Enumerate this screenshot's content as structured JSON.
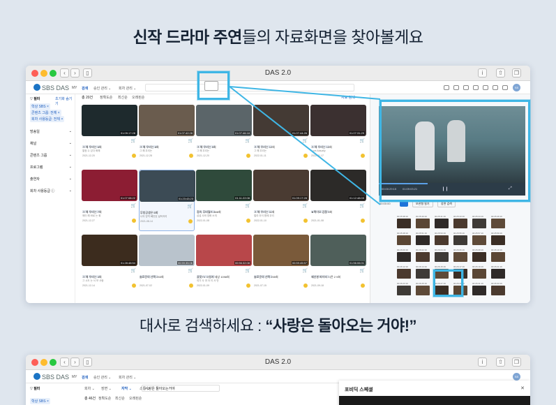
{
  "headline1": {
    "bold": "신작 드라마 주연",
    "rest": "들의 자료화면을 찾아볼게요"
  },
  "headline2": {
    "pre": "대사로 검색하세요 : ",
    "quote": "“사랑은 돌아오는 거야!”"
  },
  "window1": {
    "title": "DAS 2.0",
    "app_logo": "SBS DAS",
    "nav": [
      "MY",
      "검색",
      "승인 관리 ⌄",
      "회차 관리 ⌄"
    ],
    "search_placeholder": "",
    "filter_label": "필터",
    "filter_actions": [
      "초기화",
      "숨기기"
    ],
    "chips": [
      "학상 SBS ×",
      "콘텐츠 그룹: 전체 ×",
      "회차 사용등급: 전체 ×"
    ],
    "side_sections": [
      "방송일",
      "채널",
      "콘텐츠 그룹",
      "프로그램",
      "출연자",
      "회차 사용등급 ⓘ"
    ],
    "tabs": [
      "총 20건",
      "정확도순",
      "최신순",
      "오래된순"
    ],
    "top_right_link": "자료 검색",
    "cards": [
      {
        "dur": "01:09:17:28",
        "title": "그 해 우리는 6회",
        "sub": "열정 수 있다 화해",
        "date": "2021-12-20",
        "bg": "#1e2a2d"
      },
      {
        "dur": "01:07:42:28",
        "title": "그 해 우리는 8회",
        "sub": "그 해 우리는",
        "date": "2021-12-28",
        "bg": "#6a5c4e"
      },
      {
        "dur": "01:07:46:18",
        "title": "그 해 우리는 5회",
        "sub": "그 해 우리는",
        "date": "2021-12-20",
        "bg": "#5b6569"
      },
      {
        "dur": "01:07:44:26",
        "title": "그 해 우리는 12회",
        "sub": "그 해 우리는",
        "date": "2022-01-11",
        "bg": "#443a34"
      },
      {
        "dur": "01:07:31:29",
        "title": "그 해 우리는 13회",
        "sub": "Love Actually",
        "date": "2022-01-17",
        "bg": "#3b3030"
      },
      {
        "dur": "01:07:08:22",
        "title": "그 해 우리는 7회",
        "sub": "에이 해 바로 는 회",
        "date": "2021-12-27",
        "bg": "#8c1d33"
      },
      {
        "dur": "01:23:43:23",
        "title": "무빙공생은 6회",
        "sub": "너의 영역 빼앗았 설득하여",
        "date": "2021-08-14",
        "bg": "#3c4b55"
      },
      {
        "dur": "01:11:22:08",
        "title": "접속 무비월드 866회",
        "sub": "섭섭 사와 영화 소개",
        "date": "2022-01-08",
        "bg": "#2f4a3b"
      },
      {
        "dur": "01:09:17:28",
        "title": "그 해 우리는 11회",
        "sub": "멀리 아이 함께 우리",
        "date": "2022-01-10",
        "bg": "#4a3b32"
      },
      {
        "dur": "01:12:48:03",
        "title": "★택이오 검찰 9회",
        "sub": "",
        "date": "2021-01-08",
        "bg": "#2c2a28"
      },
      {
        "dur": "01:28:48:54",
        "title": "그 해 우리는 4회",
        "sub": "그 시도 는 서 보 사랑",
        "date": "2021-12-14",
        "bg": "#3c2c1e"
      },
      {
        "dur": "00:59:35:06",
        "title": "술료운의 선택 253회",
        "sub": "",
        "date": "2021-07-02",
        "bg": "#b9c3cc"
      },
      {
        "dur": "00:56:32:08",
        "title": "골밋TV 시청자 세상 1098회",
        "sub": "여가 사 과 아 이 서 만",
        "date": "2022-01-09",
        "bg": "#b8474a"
      },
      {
        "dur": "00:59:45:57",
        "title": "술료운의 선택 255회",
        "sub": "",
        "date": "2021-07-15",
        "bg": "#7a5a3a"
      },
      {
        "dur": "01:56:06:01",
        "title": "궤선봉 파이터 시즌 2 9회",
        "sub": "",
        "date": "2021-09-18",
        "bg": "#4f5f5a"
      }
    ],
    "player": {
      "time_current": "00:00:29:15",
      "time_total": "01:09:03:21"
    },
    "scene_tabs": [
      "00:00:00",
      "보관형 필기",
      "장면 검색"
    ],
    "scene_times": [
      "00:25:38:19",
      "00:25:40:19",
      "00:25:41:19",
      "00:25:43:19",
      "00:25:44:19",
      "00:25:46:19",
      "00:25:48:19",
      "00:25:51:19",
      "00:25:53:19",
      "00:25:55:19",
      "00:25:57:19",
      "00:25:59:19",
      "00:26:00:19",
      "00:26:02:19",
      "00:26:04:19",
      "00:26:06:19",
      "00:26:08:19",
      "00:26:10:19",
      "00:26:12:19",
      "00:26:14:19",
      "00:26:15:19",
      "00:26:17:19",
      "00:26:19:19",
      "00:26:21:19",
      "00:26:23:19",
      "00:26:25:19",
      "00:26:27:19",
      "00:26:29:19",
      "00:26:31:19",
      "00:26:33:19"
    ]
  },
  "window2": {
    "title": "DAS 2.0",
    "app_logo": "SBS DAS",
    "nav": [
      "MY",
      "검색",
      "승인 관리 ⌄",
      "회차 관리 ⌄"
    ],
    "filter_tabs": [
      "회차 ⌄",
      "장면 ⌄",
      "자막 ⌄",
      "소통 ⌄"
    ],
    "query": "사랑은 돌아오는거야",
    "chip": "학상 SBS ×",
    "tabs": [
      "총 46건",
      "정확도순",
      "최신순",
      "오래된순"
    ],
    "modal_title": "포비딕 스페셜",
    "modal_close": "✕"
  },
  "colors": {
    "accent": "#1f5fbf",
    "highlight": "#3fb6e5",
    "bg": "#dfe6ee"
  }
}
